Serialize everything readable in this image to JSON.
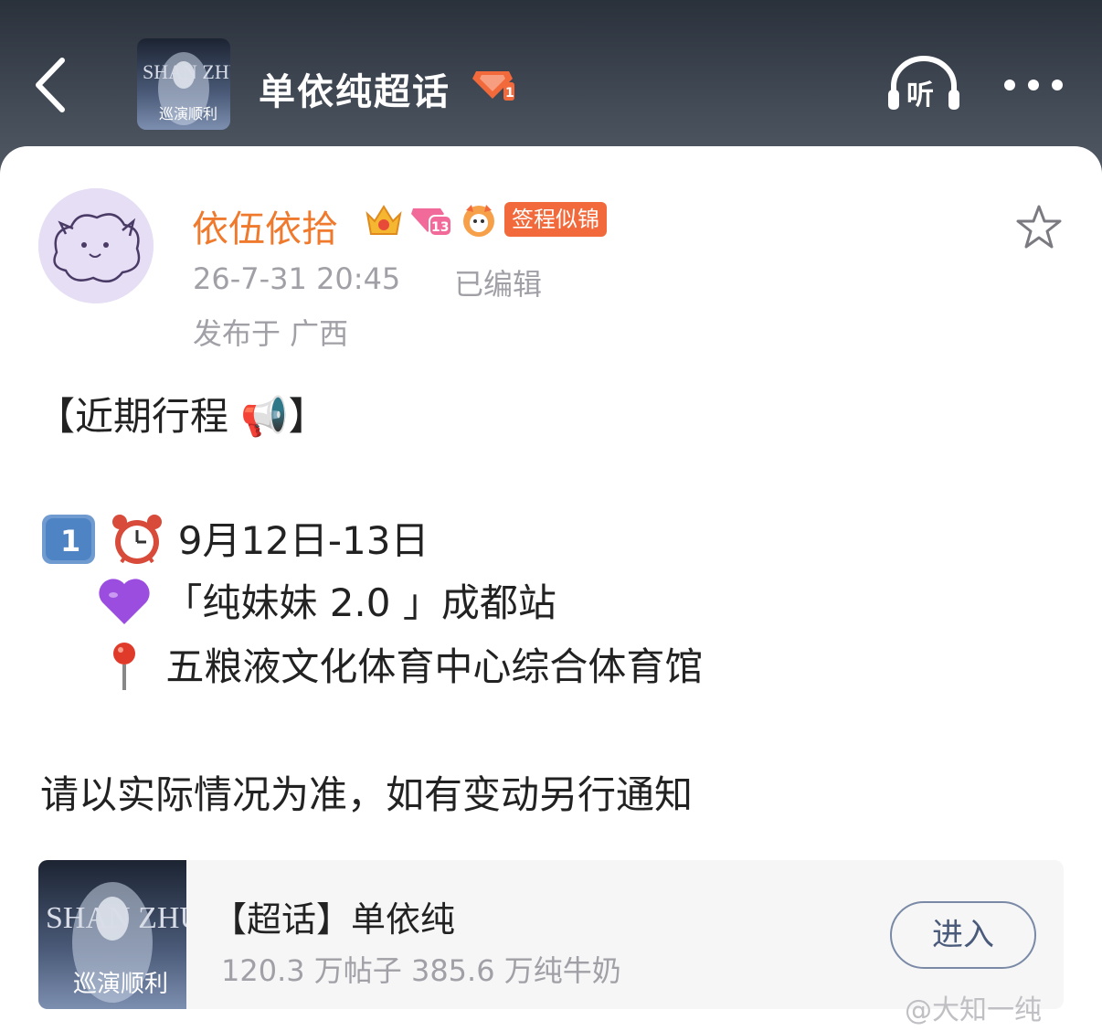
{
  "header": {
    "title": "单依纯超话",
    "cover_text_top": "SHAN ZHUN",
    "cover_text_bottom": "巡演顺利",
    "listen_label": "听"
  },
  "post": {
    "author": "依伍依拾",
    "level_badge": "13",
    "sign_tag": "签程似锦",
    "time": "26-7-31 20:45",
    "edited": "已编辑",
    "location": "发布于 广西",
    "line_title": "【近期行程 📢】",
    "line_date": "9月12日-13日",
    "line_event": "「纯妹妹 2.0 」成都站",
    "line_venue": "五粮液文化体育中心综合体育馆",
    "line_note": "请以实际情况为准，如有变动另行通知",
    "num_1": "1"
  },
  "topic_card": {
    "title": "【超话】单依纯",
    "stats": "120.3 万帖子 385.6 万纯牛奶",
    "enter_label": "进入",
    "cover_text_top": "SHAN ZHUN",
    "cover_text_bottom": "巡演顺利"
  },
  "watermark": "@大知一纯",
  "colors": {
    "username": "#ef7a2e",
    "sign_tag": "#f26a3b",
    "meta": "#a0a0a6",
    "header_bg": "#3a414c"
  }
}
